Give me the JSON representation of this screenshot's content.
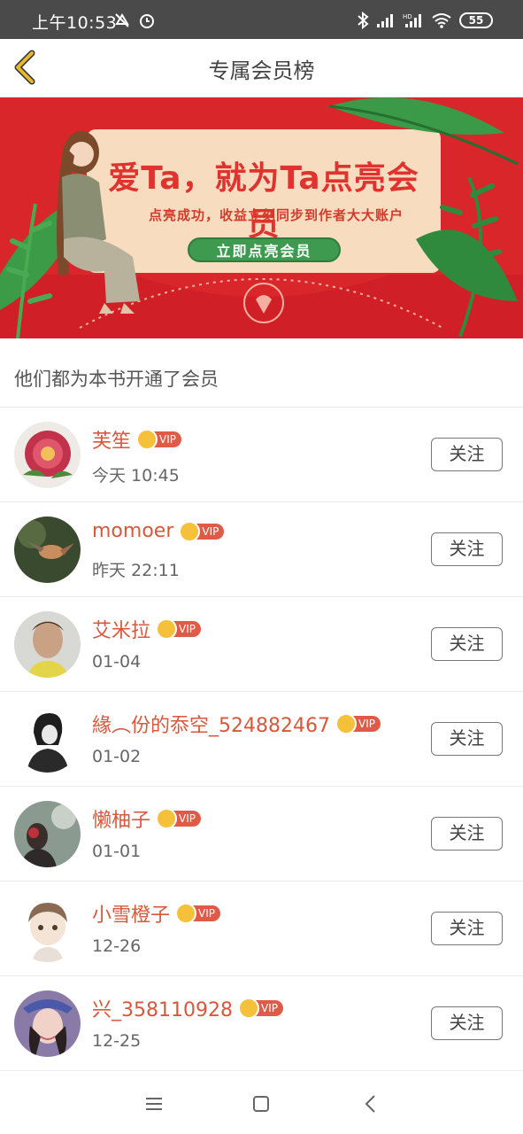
{
  "status_bar": {
    "time": "上午10:53",
    "battery": "55",
    "icons": [
      "mute-icon",
      "alarm-icon",
      "bluetooth-icon",
      "signal-icon",
      "hd-signal-icon",
      "wifi-icon"
    ]
  },
  "header": {
    "title": "专属会员榜",
    "back_icon": "chevron-left-icon",
    "accent_color": "#e5b82f"
  },
  "banner": {
    "headline": "爱Ta，就为Ta点亮会员",
    "subtitle": "点亮成功，收益立刻同步到作者大大账户",
    "cta": "立即点亮会员"
  },
  "section_title": "他们都为本书开通了会员",
  "vip_label": "VIP",
  "follow_label": "关注",
  "members": [
    {
      "name": "芙笙",
      "date": "今天 10:45"
    },
    {
      "name": "momoer",
      "date": "昨天 22:11"
    },
    {
      "name": "艾米拉",
      "date": "01-04"
    },
    {
      "name": "緣︵份的忝空_524882467",
      "date": "01-02"
    },
    {
      "name": "懒柚子",
      "date": "01-01"
    },
    {
      "name": "小雪橙子",
      "date": "12-26"
    },
    {
      "name": "兴_358110928",
      "date": "12-25"
    }
  ],
  "nav": {
    "menu_icon": "menu-icon",
    "home_icon": "home-square-icon",
    "back_icon": "back-triangle-icon"
  }
}
